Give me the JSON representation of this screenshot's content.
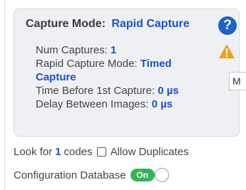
{
  "capture_card": {
    "mode_label": "Capture Mode:",
    "mode_value": "Rapid Capture",
    "details": {
      "num_captures_label": "Num Captures:",
      "num_captures_value": "1",
      "rapid_mode_label": "Rapid Capture Mode:",
      "rapid_mode_value": "Timed Capture",
      "time_before_label": "Time Before 1st Capture:",
      "time_before_value": "0 µs",
      "delay_label": "Delay Between Images:",
      "delay_value": "0 µs"
    },
    "icons": {
      "help": "help-icon",
      "warning": "warning-icon"
    }
  },
  "tooltip_stub": "M",
  "look_for": {
    "prefix": "Look for",
    "count": "1",
    "suffix": "codes",
    "allow_duplicates_label": "Allow Duplicates",
    "allow_duplicates_checked": false
  },
  "config_db": {
    "label": "Configuration Database",
    "toggle_text": "On",
    "toggle_state": true
  },
  "colors": {
    "accent": "#1f4fd1",
    "help_blue": "#1e63c6",
    "warning": "#f0a020",
    "toggle_green": "#35b35a"
  }
}
